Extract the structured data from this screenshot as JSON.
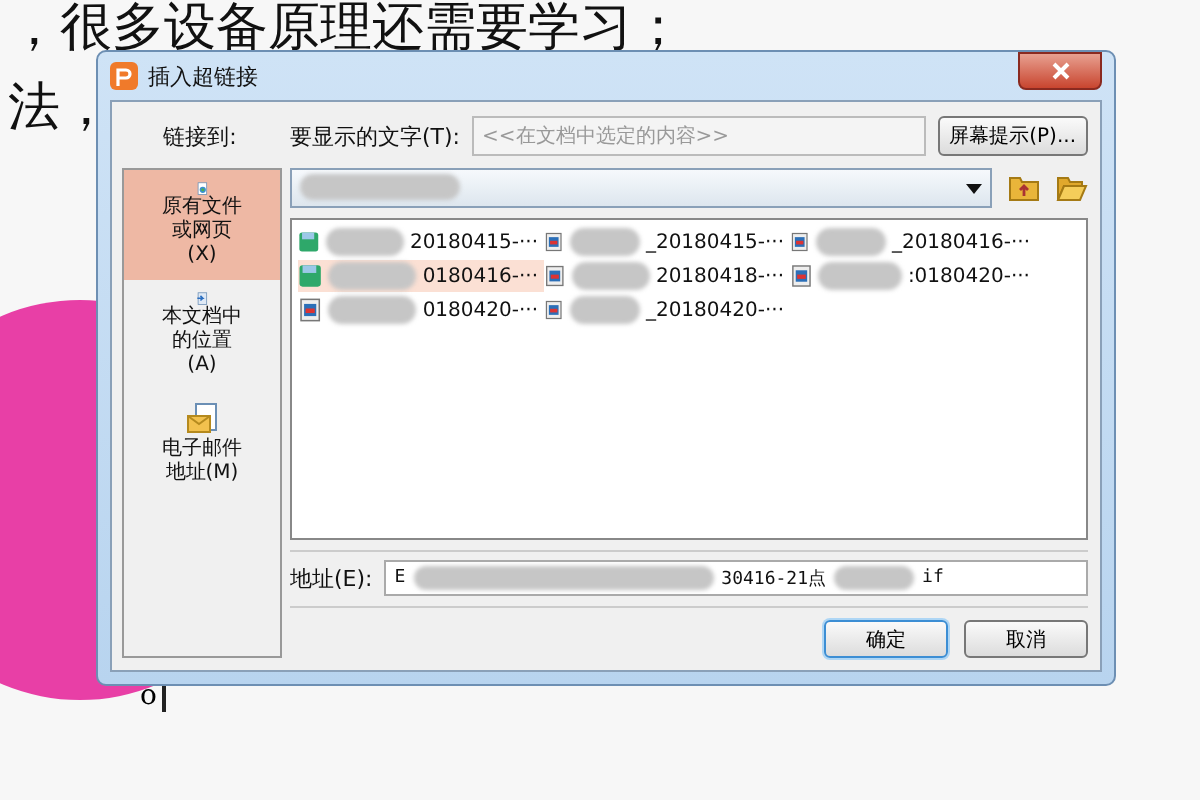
{
  "document": {
    "lines": [
      "，很多设备原理还需要学习；",
      "法，"
    ],
    "cursor_text": "o"
  },
  "dialog": {
    "title": "插入超链接",
    "link_to_label": "链接到:",
    "display_text_label": "要显示的文字(T):",
    "display_text_placeholder": "<<在文档中选定的内容>>",
    "screen_tip_button": "屏幕提示(P)...",
    "sidebar_items": [
      {
        "label": "原有文件或网页(X)",
        "selected": true,
        "kind": "file"
      },
      {
        "label": "本文档中的位置(A)",
        "selected": false,
        "kind": "place"
      },
      {
        "label": "电子邮件地址(M)",
        "selected": false,
        "kind": "mail"
      }
    ],
    "files": [
      {
        "name": "20180415-···",
        "kind": "gif",
        "selected": false
      },
      {
        "name": "0180416-···",
        "kind": "gif",
        "selected": true
      },
      {
        "name": "0180420-···",
        "kind": "image",
        "selected": false
      },
      {
        "name": "_20180415-···",
        "kind": "image",
        "selected": false
      },
      {
        "name": "20180418-···",
        "kind": "image",
        "selected": false
      },
      {
        "name": "_20180420-···",
        "kind": "image",
        "selected": false
      },
      {
        "name": "_20180416-···",
        "kind": "image",
        "selected": false
      },
      {
        "name": ":0180420-···",
        "kind": "image",
        "selected": false
      }
    ],
    "address_label": "地址(E):",
    "address_parts": [
      "E",
      "30416-21点",
      "if"
    ],
    "ok_button": "确定",
    "cancel_button": "取消"
  }
}
